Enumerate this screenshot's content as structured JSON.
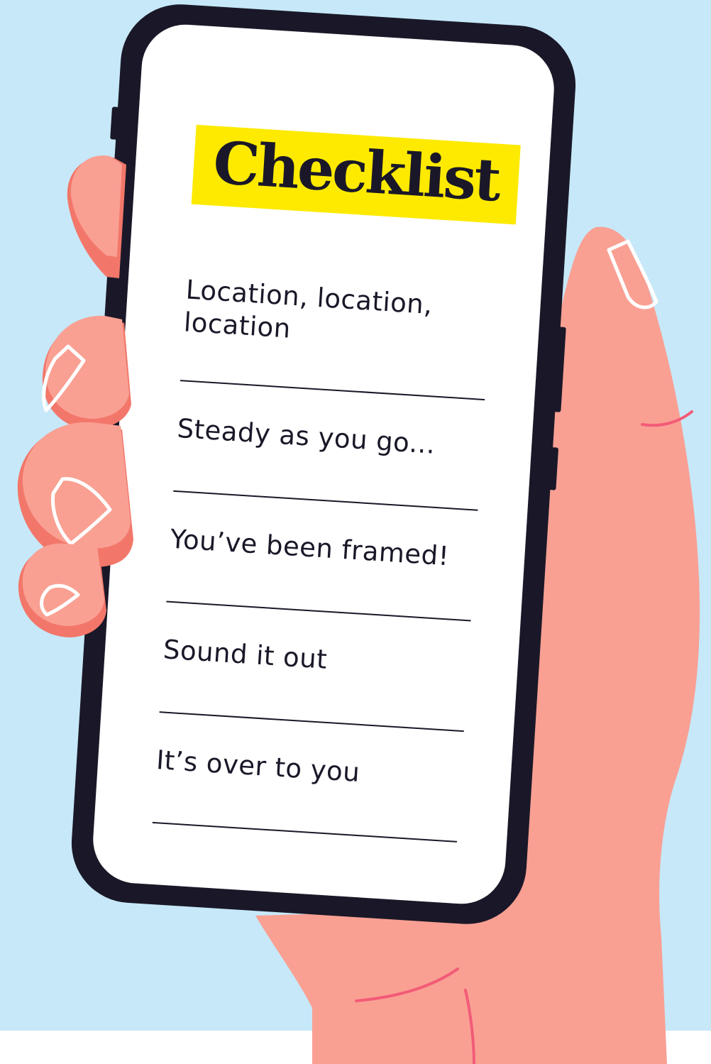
{
  "checklist": {
    "title": "Checklist",
    "items": [
      {
        "label": "Location, location, location"
      },
      {
        "label": "Steady as you go..."
      },
      {
        "label": "You’ve been framed!"
      },
      {
        "label": "Sound it out"
      },
      {
        "label": "It’s over to you"
      }
    ]
  },
  "colors": {
    "background": "#c7e8f8",
    "phone": "#1a1828",
    "highlight": "#fdea00",
    "skin": "#f9a093",
    "skin_shadow": "#f2776a",
    "crease": "#f25b78"
  }
}
